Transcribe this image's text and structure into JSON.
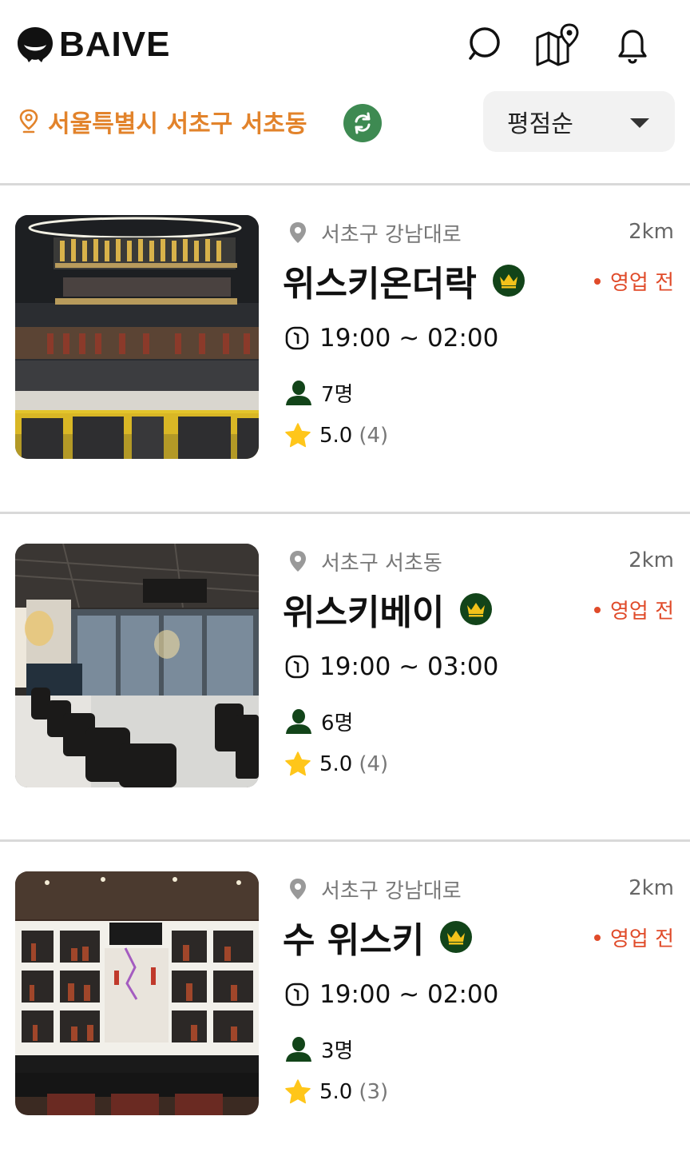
{
  "app": {
    "name": "BAIVE"
  },
  "location": {
    "text": "서울특별시 서초구 서초동"
  },
  "sort": {
    "selected": "평점순"
  },
  "colors": {
    "accent": "#e2832b",
    "refresh": "#3e8a52",
    "crown_bg": "#124419",
    "crown": "#f2c21b",
    "status": "#e04b2a",
    "star": "#ffc61a"
  },
  "icons": {
    "logo": "logo-mark-icon",
    "search": "search-icon",
    "map": "map-pin-icon",
    "bell": "bell-icon",
    "location": "location-pin-icon",
    "refresh": "refresh-icon",
    "clock": "clock-icon",
    "person": "person-icon",
    "star": "star-icon",
    "crown": "crown-icon"
  },
  "venues": [
    {
      "address": "서초구 강남대로",
      "distance": "2km",
      "name": "위스키온더락",
      "status": "영업 전",
      "hours": "19:00 ~ 02:00",
      "capacity": "7명",
      "rating": "5.0",
      "reviews": "(4)"
    },
    {
      "address": "서초구 서초동",
      "distance": "2km",
      "name": "위스키베이",
      "status": "영업 전",
      "hours": "19:00 ~ 03:00",
      "capacity": "6명",
      "rating": "5.0",
      "reviews": "(4)"
    },
    {
      "address": "서초구 강남대로",
      "distance": "2km",
      "name": "수 위스키",
      "status": "영업 전",
      "hours": "19:00 ~ 02:00",
      "capacity": "3명",
      "rating": "5.0",
      "reviews": "(3)"
    }
  ]
}
